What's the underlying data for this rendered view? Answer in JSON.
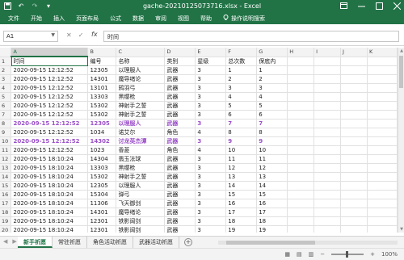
{
  "window": {
    "title": "gache-20210125073716.xlsx  -  Excel",
    "icons": [
      "save-icon",
      "undo-icon",
      "redo-icon",
      "customize-icon"
    ],
    "controls": [
      "ribbon-display-icon",
      "minimize-icon",
      "maximize-icon",
      "close-icon"
    ]
  },
  "ribbon": {
    "tabs": [
      "文件",
      "开始",
      "插入",
      "页面布局",
      "公式",
      "数据",
      "审阅",
      "视图",
      "帮助"
    ],
    "tell_me": "操作说明搜索"
  },
  "formula_bar": {
    "name_box": "A1",
    "value": "时间"
  },
  "sheet": {
    "columns": [
      "A",
      "B",
      "C",
      "D",
      "E",
      "F",
      "G",
      "H",
      "I",
      "J",
      "K"
    ],
    "row_numbers": [
      "1",
      "2",
      "3",
      "4",
      "5",
      "6",
      "7",
      "8",
      "9",
      "10",
      "11",
      "12",
      "13",
      "14",
      "15",
      "16",
      "17",
      "18",
      "19",
      "20",
      "21"
    ],
    "rows": [
      [
        "时间",
        "编号",
        "名称",
        "类别",
        "星级",
        "总次数",
        "保底内"
      ],
      [
        "2020-09-15 12:12:52",
        "12305",
        "以理服人",
        "武器",
        "3",
        "1",
        "1"
      ],
      [
        "2020-09-15 12:12:52",
        "14301",
        "魔导绪论",
        "武器",
        "3",
        "2",
        "2"
      ],
      [
        "2020-09-15 12:12:52",
        "13101",
        "鸦羽弓",
        "武器",
        "3",
        "3",
        "3"
      ],
      [
        "2020-09-15 12:12:52",
        "13303",
        "黑缨枪",
        "武器",
        "3",
        "4",
        "4"
      ],
      [
        "2020-09-15 12:12:52",
        "15302",
        "神射手之誓",
        "武器",
        "3",
        "5",
        "5"
      ],
      [
        "2020-09-15 12:12:52",
        "15302",
        "神射手之誓",
        "武器",
        "3",
        "6",
        "6"
      ],
      [
        "2020-09-15 12:12:52",
        "12305",
        "以理服人",
        "武器",
        "3",
        "7",
        "7"
      ],
      [
        "2020-09-15 12:12:52",
        "1034",
        "诺艾尔",
        "角色",
        "4",
        "8",
        "8"
      ],
      [
        "2020-09-15 12:12:52",
        "14302",
        "讨龙英杰谭",
        "武器",
        "3",
        "9",
        "9"
      ],
      [
        "2020-09-15 12:12:52",
        "1023",
        "香菱",
        "角色",
        "4",
        "10",
        "10"
      ],
      [
        "2020-09-15 18:10:24",
        "14304",
        "翡玉法球",
        "武器",
        "3",
        "11",
        "11"
      ],
      [
        "2020-09-15 18:10:24",
        "13303",
        "黑缨枪",
        "武器",
        "3",
        "12",
        "12"
      ],
      [
        "2020-09-15 18:10:24",
        "15302",
        "神射手之誓",
        "武器",
        "3",
        "13",
        "13"
      ],
      [
        "2020-09-15 18:10:24",
        "12305",
        "以理服人",
        "武器",
        "3",
        "14",
        "14"
      ],
      [
        "2020-09-15 18:10:24",
        "15304",
        "弹弓",
        "武器",
        "3",
        "15",
        "15"
      ],
      [
        "2020-09-15 18:10:24",
        "11306",
        "飞天御剑",
        "武器",
        "3",
        "16",
        "16"
      ],
      [
        "2020-09-15 18:10:24",
        "14301",
        "魔导绪论",
        "武器",
        "3",
        "17",
        "17"
      ],
      [
        "2020-09-15 18:10:24",
        "12301",
        "铁影阔剑",
        "武器",
        "3",
        "18",
        "18"
      ],
      [
        "2020-09-15 18:10:24",
        "12301",
        "铁影阔剑",
        "武器",
        "3",
        "19",
        "19"
      ],
      [
        "2020-09-15 18:10:24",
        "12301",
        "铁影阔剑",
        "武器",
        "3",
        "20",
        "20"
      ]
    ],
    "highlight_rows": [
      8,
      10
    ],
    "highlight_color": "#9b4fc9"
  },
  "sheet_tabs": {
    "tabs": [
      "新手祈愿",
      "常驻祈愿",
      "角色活动祈愿",
      "武器活动祈愿"
    ],
    "active": 0
  },
  "status": {
    "zoom": "100%"
  },
  "colors": {
    "brand": "#217346"
  }
}
